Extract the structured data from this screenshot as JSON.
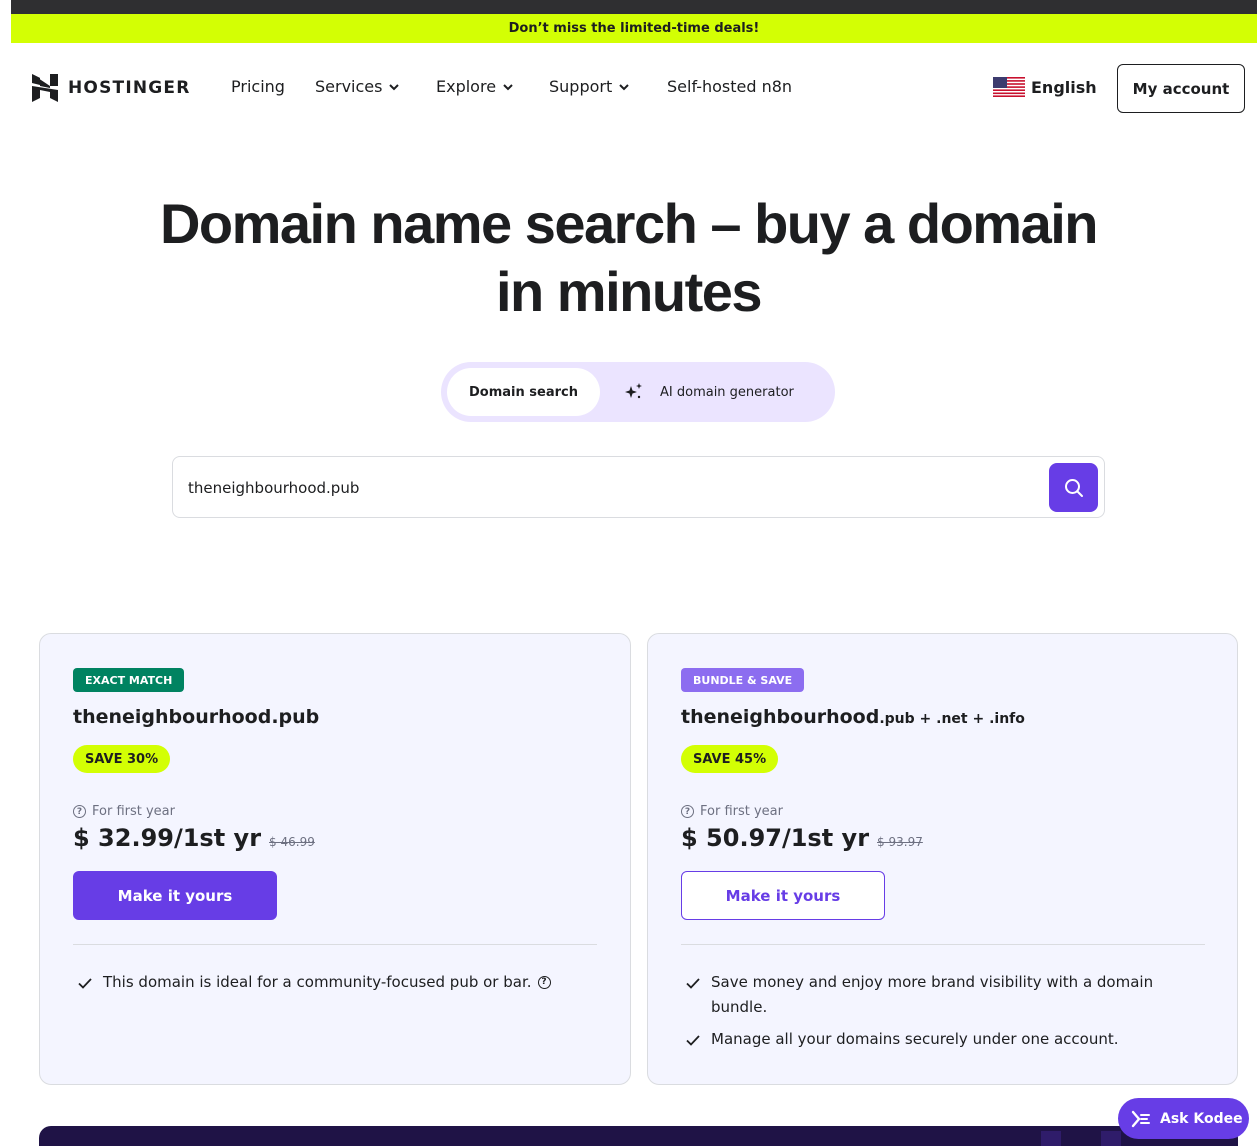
{
  "promo": {
    "text": "Don’t miss the limited-time deals!"
  },
  "nav": {
    "brand": "HOSTINGER",
    "items": [
      {
        "label": "Pricing",
        "dropdown": false
      },
      {
        "label": "Services",
        "dropdown": true
      },
      {
        "label": "Explore",
        "dropdown": true
      },
      {
        "label": "Support",
        "dropdown": true
      },
      {
        "label": "Self-hosted n8n",
        "dropdown": false
      }
    ],
    "language": "English",
    "account": "My account"
  },
  "hero": {
    "title_line1": "Domain name search – buy a domain",
    "title_line2": "in minutes"
  },
  "tabs": {
    "domain_search": "Domain search",
    "ai_generator": "AI domain generator"
  },
  "search": {
    "value": "theneighbourhood.pub",
    "placeholder": ""
  },
  "cards": [
    {
      "badge": "EXACT MATCH",
      "domain": "theneighbourhood.pub",
      "extra_tlds": "",
      "save": "SAVE 30%",
      "first_year_label": "For first year",
      "price": "$ 32.99/1st yr",
      "old_price": "$ 46.99",
      "cta": "Make it yours",
      "features": [
        "This domain is ideal for a community-focused pub or bar."
      ]
    },
    {
      "badge": "BUNDLE & SAVE",
      "domain": "theneighbourhood",
      "extra_tlds": ".pub + .net + .info",
      "save": "SAVE 45%",
      "first_year_label": "For first year",
      "price": "$ 50.97/1st yr",
      "old_price": "$ 93.97",
      "cta": "Make it yours",
      "features": [
        "Save money and enjoy more brand visibility with a domain",
        "bundle.",
        "Manage all your domains securely under one account."
      ]
    }
  ],
  "assistant": {
    "label": "Ask Kodee"
  },
  "colors": {
    "promo_bg": "#d3ff04",
    "primary": "#673de6",
    "exact_badge": "#008361",
    "bundle_badge": "#8c6df0",
    "card_bg": "#f4f5ff"
  }
}
